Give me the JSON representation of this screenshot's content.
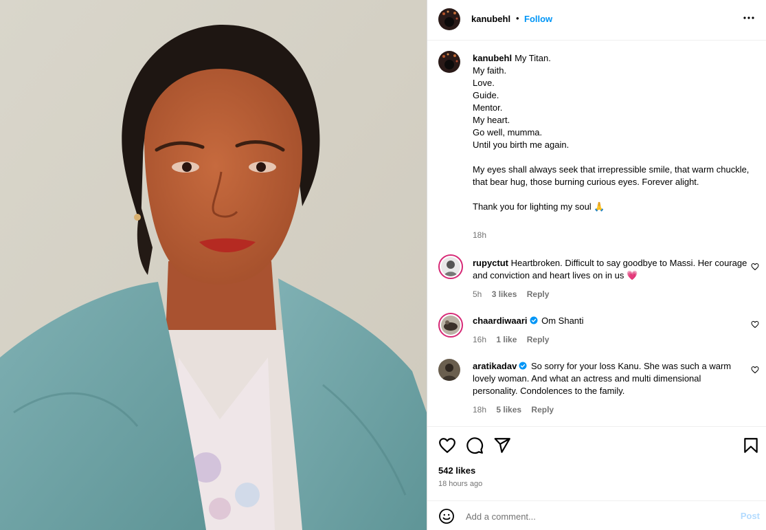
{
  "post": {
    "username": "kanubehl",
    "follow_label": "Follow",
    "separator": "•"
  },
  "caption": {
    "username": "kanubehl",
    "lines": [
      "My Titan.",
      "My faith.",
      "Love.",
      "Guide.",
      "Mentor.",
      "My heart.",
      "Go well, mumma.",
      "Until you birth me again.",
      "",
      "My eyes shall always seek that irrepressible smile, that warm chuckle, that bear hug, those burning curious eyes. Forever alight.",
      "",
      "Thank you for lighting my soul 🙏"
    ],
    "time": "18h"
  },
  "comments": [
    {
      "username": "rupyctut",
      "verified": false,
      "text": "Heartbroken. Difficult to say goodbye to Massi. Her courage and conviction and heart lives on in us 💗",
      "time": "5h",
      "likes": "3 likes",
      "reply": "Reply"
    },
    {
      "username": "chaardiwaari",
      "verified": true,
      "text": "Om Shanti",
      "time": "16h",
      "likes": "1 like",
      "reply": "Reply"
    },
    {
      "username": "aratikadav",
      "verified": true,
      "text": "So sorry for your loss Kanu. She was such a warm lovely woman. And what an actress and multi dimensional personality. Condolences to the family.",
      "time": "18h",
      "likes": "5 likes",
      "reply": "Reply"
    }
  ],
  "footer": {
    "likes": "542 likes",
    "posted_ago": "18 hours ago",
    "comment_placeholder": "Add a comment...",
    "post_label": "Post"
  },
  "icons": {
    "more": "more-options-icon",
    "like": "heart-icon",
    "comment": "comment-icon",
    "share": "share-icon",
    "save": "bookmark-icon",
    "emoji": "emoji-icon",
    "verified": "verified-badge-icon"
  },
  "colors": {
    "link": "#0095f6",
    "secondary_text": "#737373",
    "post_disabled": "#b3dbff",
    "verified": "#0095f6"
  }
}
